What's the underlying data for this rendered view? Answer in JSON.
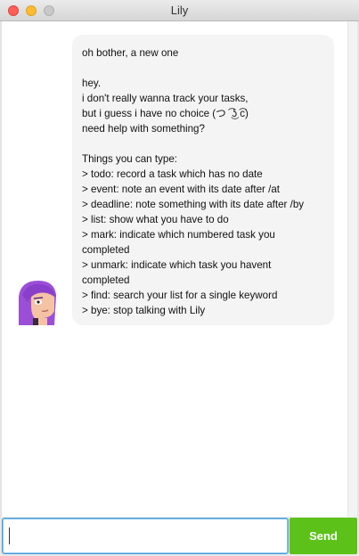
{
  "window": {
    "title": "Lily"
  },
  "chat": {
    "messages": [
      {
        "sender_avatar": "lily-avatar",
        "lines": [
          "oh bother, a new one",
          "",
          "hey.",
          "i don't really wanna track your tasks,",
          "but i guess i have no choice (つ ͡ ͜ʖ ͡c)",
          "need help with something?",
          "",
          "Things you can type:",
          "> todo: record a task which has no date",
          "> event: note an event with its date after /at",
          "> deadline: note something with its date after /by",
          "> list: show what you have to do",
          "> mark: indicate which numbered task you",
          "completed",
          "> unmark: indicate which task you havent",
          "completed",
          "> find: search your list for a single keyword",
          "> bye: stop talking with Lily"
        ]
      }
    ]
  },
  "input": {
    "value": "",
    "placeholder": ""
  },
  "send_button": {
    "label": "Send"
  },
  "colors": {
    "send_button": "#5cc219",
    "bubble": "#f4f4f4",
    "input_focus": "#4a9eda"
  }
}
